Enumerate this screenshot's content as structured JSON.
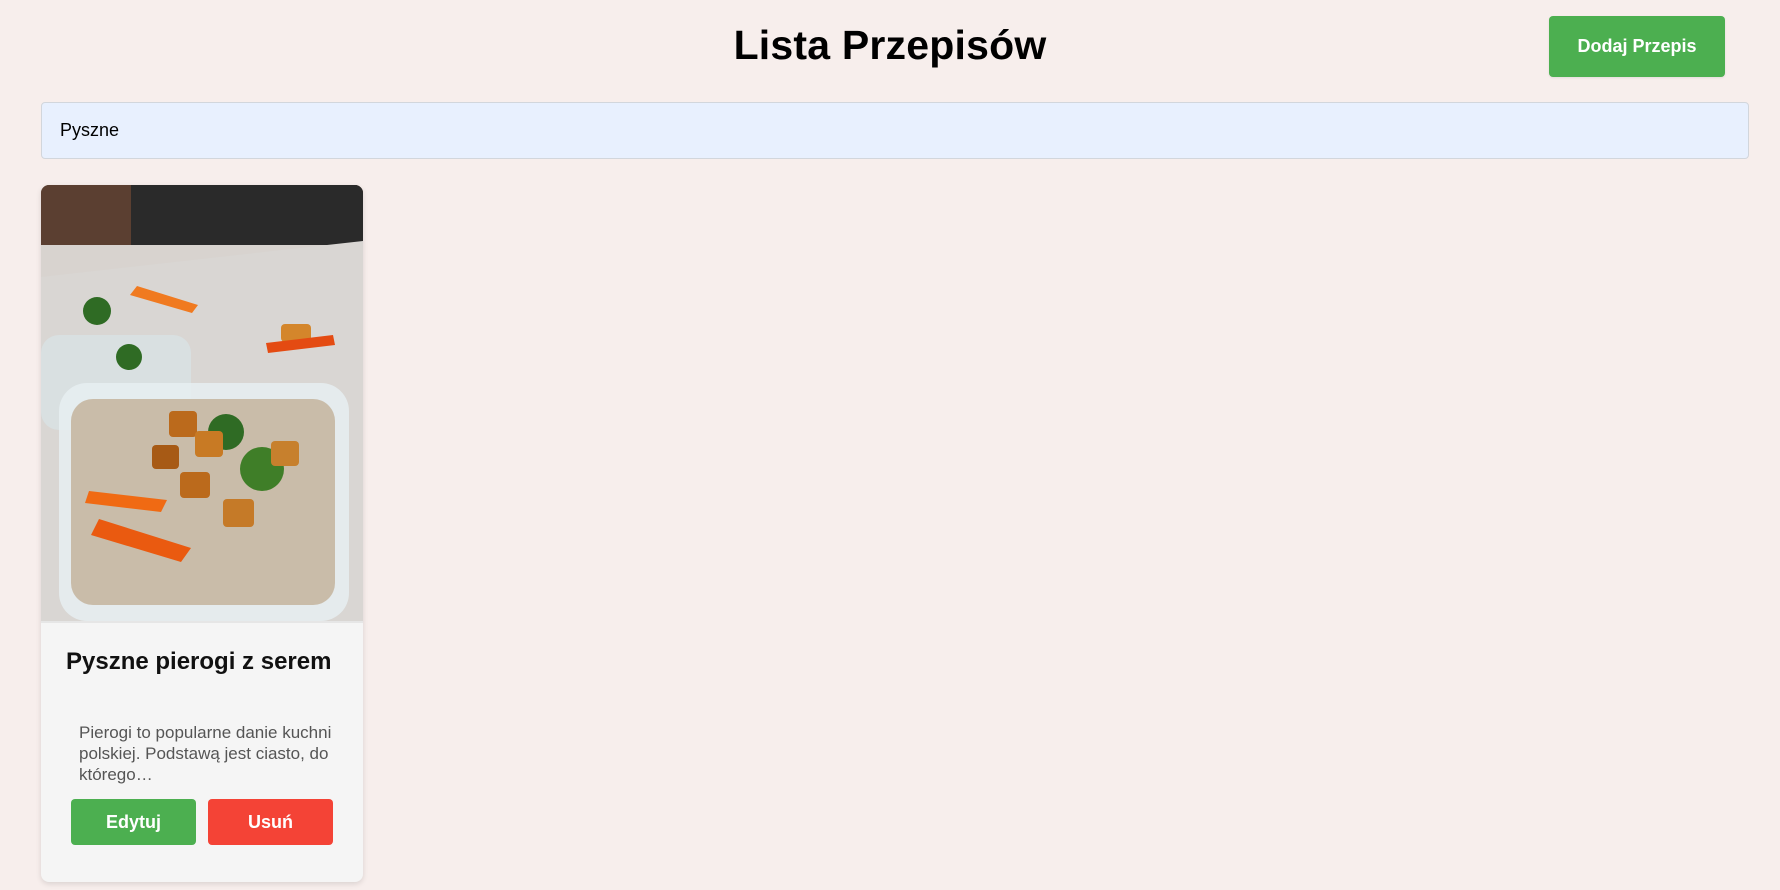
{
  "header": {
    "title": "Lista Przepisów",
    "add_button_label": "Dodaj Przepis"
  },
  "search": {
    "value": "Pyszne",
    "placeholder": ""
  },
  "recipes": [
    {
      "title": "Pyszne pierogi z serem",
      "description": "Pierogi to popularne danie kuchni polskiej. Podstawą jest ciasto, do którego…",
      "edit_label": "Edytuj",
      "delete_label": "Usuń",
      "image_icon": "food-photo"
    }
  ],
  "colors": {
    "background": "#f7eeec",
    "primary": "#4caf50",
    "danger": "#f44336",
    "search_bg": "#e8f0fe",
    "card_bg": "#f5f5f5"
  }
}
